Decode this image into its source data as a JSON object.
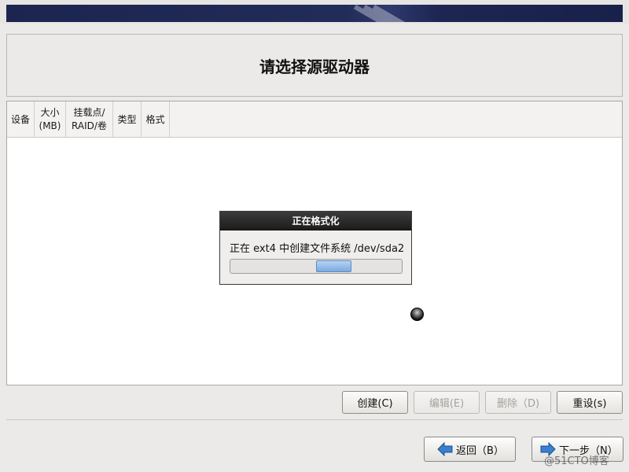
{
  "page": {
    "title": "请选择源驱动器"
  },
  "table": {
    "headers": {
      "device": "设备",
      "size": "大小\n(MB)",
      "mount": "挂载点/\nRAID/卷",
      "type": "类型",
      "format": "格式"
    }
  },
  "dialog": {
    "title": "正在格式化",
    "message": "正在 ext4 中创建文件系统 /dev/sda2",
    "progress_state": "indeterminate"
  },
  "actions": {
    "create": "创建(C)",
    "edit": "编辑(E)",
    "delete": "删除（D)",
    "reset": "重设(s)"
  },
  "navigation": {
    "back": "返回（B）",
    "next": "下一步（N）"
  },
  "watermark": "@51CTO博客",
  "colors": {
    "banner": "#1b2550",
    "dialog_title_bg": "#2a2a2a",
    "progress_fill": "#8fb6e6",
    "nav_arrow": "#2d6fc0"
  },
  "icons": {
    "back": "arrow-left-icon",
    "next": "arrow-right-icon",
    "busy": "busy-cursor-icon"
  }
}
